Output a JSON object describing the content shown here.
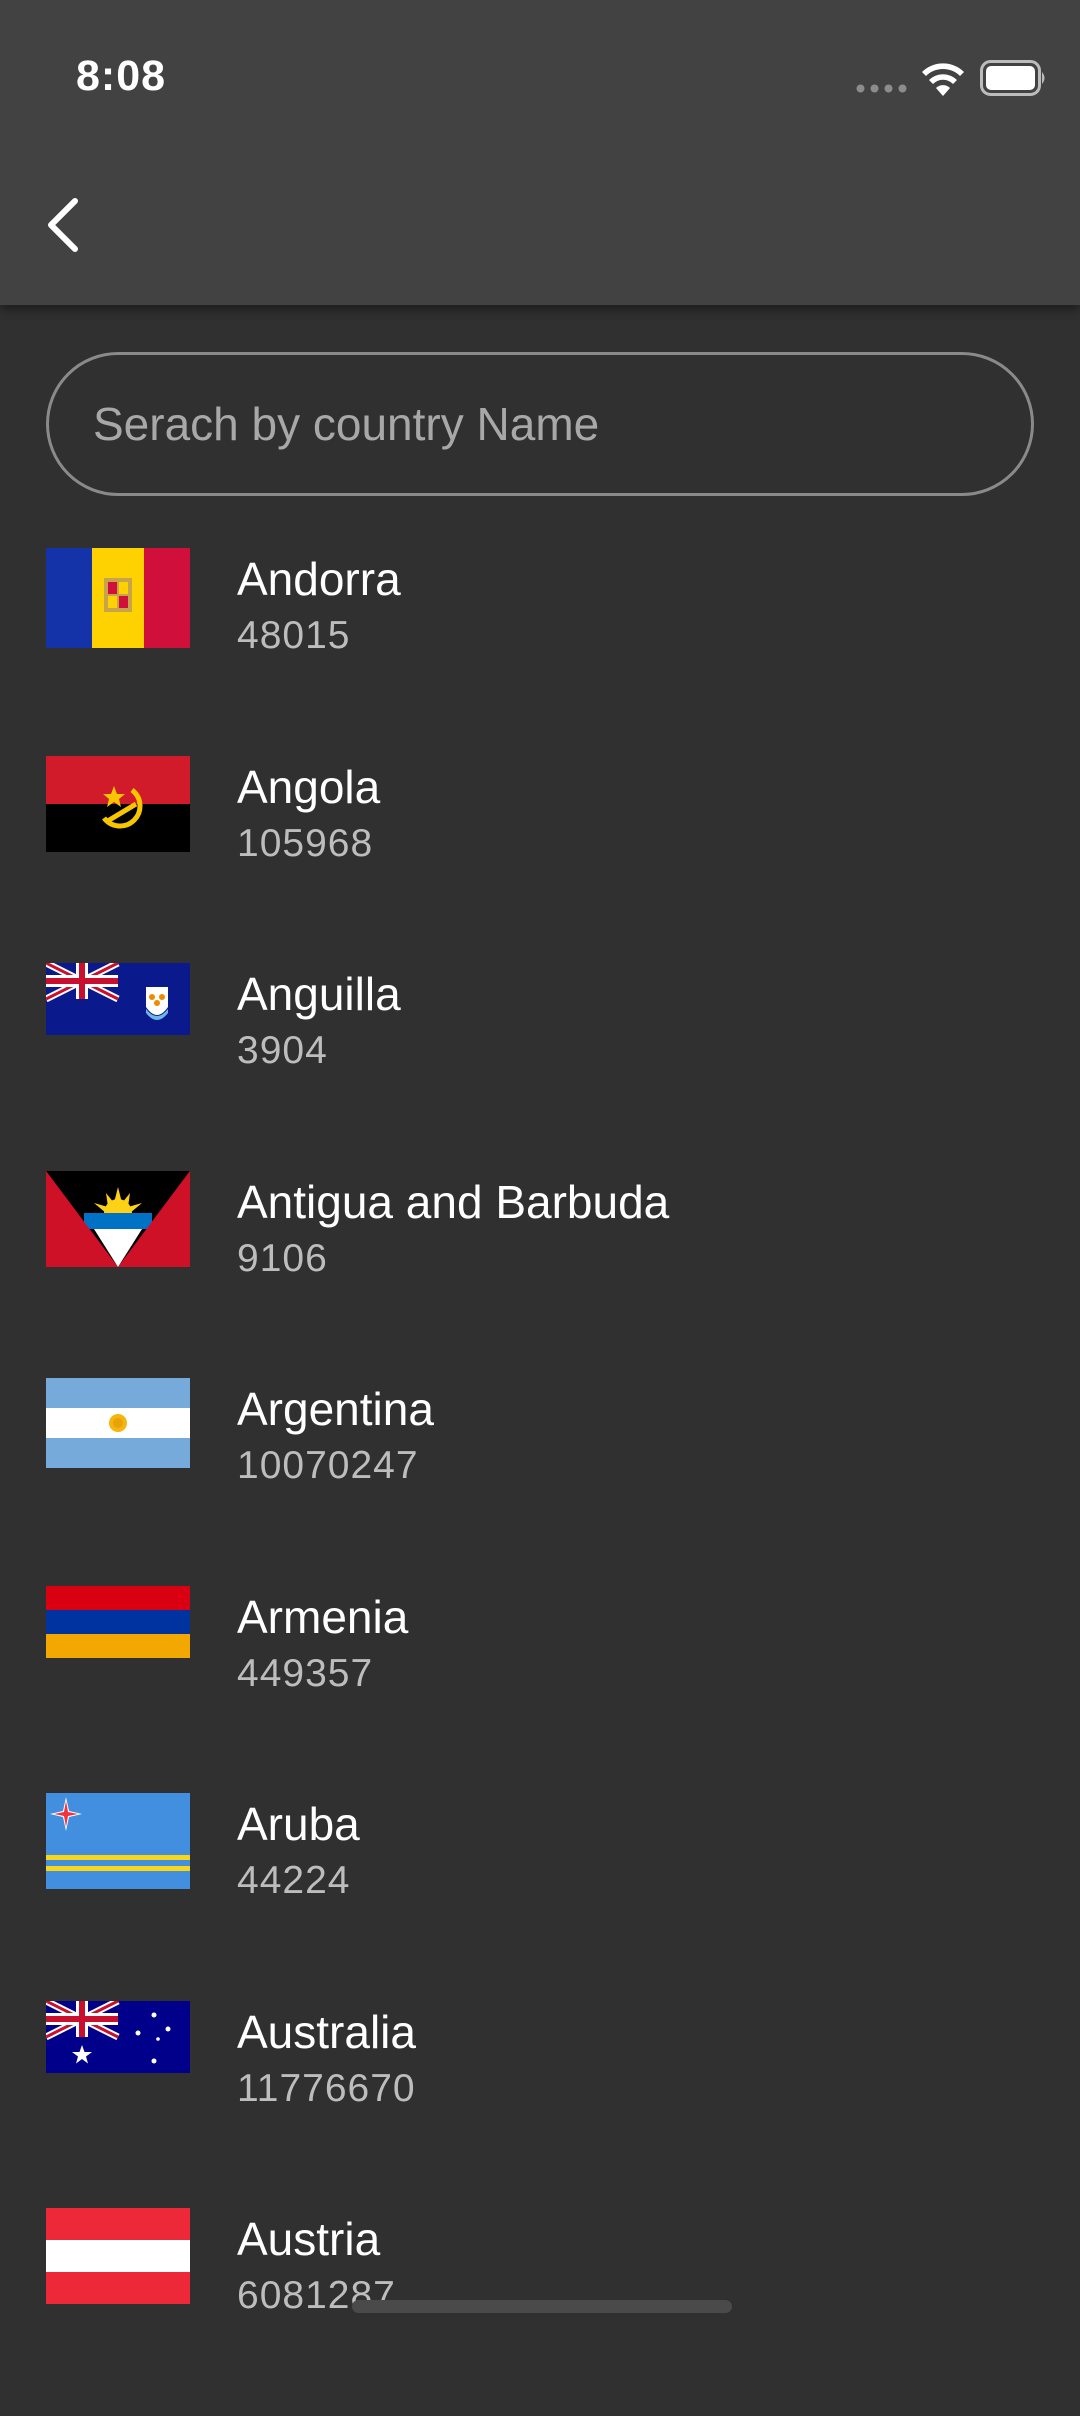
{
  "status_bar": {
    "time": "8:08",
    "icons": [
      "signal-dots-icon",
      "wifi-icon",
      "battery-icon"
    ]
  },
  "app_bar": {
    "back_icon": "chevron-left-icon"
  },
  "search": {
    "placeholder": "Serach by country Name",
    "value": ""
  },
  "countries": [
    {
      "name": "Andorra",
      "population": "48015",
      "flag": "andorra-flag-icon"
    },
    {
      "name": "Angola",
      "population": "105968",
      "flag": "angola-flag-icon"
    },
    {
      "name": "Anguilla",
      "population": "3904",
      "flag": "anguilla-flag-icon"
    },
    {
      "name": "Antigua and Barbuda",
      "population": "9106",
      "flag": "antigua-and-barbuda-flag-icon"
    },
    {
      "name": "Argentina",
      "population": "10070247",
      "flag": "argentina-flag-icon"
    },
    {
      "name": "Armenia",
      "population": "449357",
      "flag": "armenia-flag-icon"
    },
    {
      "name": "Aruba",
      "population": "44224",
      "flag": "aruba-flag-icon"
    },
    {
      "name": "Australia",
      "population": "11776670",
      "flag": "australia-flag-icon"
    },
    {
      "name": "Austria",
      "population": "6081287",
      "flag": "austria-flag-icon"
    }
  ],
  "colors": {
    "background": "#303030",
    "app_bar": "#424242",
    "primary_text": "#ffffff",
    "secondary_text": "#bdbdbd",
    "search_border": "#8a8a8a"
  }
}
